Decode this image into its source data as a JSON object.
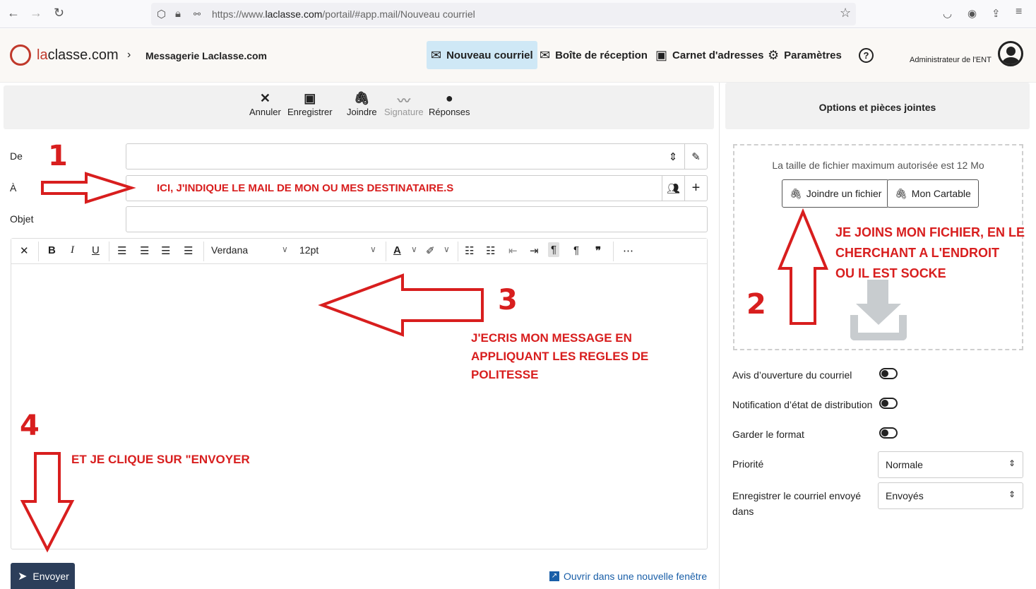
{
  "browser": {
    "url_prefix": "https://www.",
    "url_domain": "laclasse.com",
    "url_path": "/portail/#app.mail/Nouveau courriel"
  },
  "header": {
    "logo_la": "la",
    "logo_rest": "classe.com",
    "crumb": "Messagerie Laclasse.com",
    "nav": {
      "new_mail": "Nouveau courriel",
      "inbox": "Boîte de réception",
      "contacts": "Carnet d'adresses",
      "settings": "Paramètres"
    },
    "user": "Administrateur de l'ENT"
  },
  "toolbar": {
    "cancel": "Annuler",
    "save": "Enregistrer",
    "attach": "Joindre",
    "signature": "Signature",
    "replies": "Réponses"
  },
  "form": {
    "from_label": "De",
    "to_label": "À",
    "subject_label": "Objet"
  },
  "editor": {
    "font": "Verdana",
    "size": "12pt"
  },
  "side": {
    "title": "Options et pièces jointes",
    "max_size": "La taille de fichier maximum autorisée est 12 Mo",
    "attach_file": "Joindre un fichier",
    "cartable": "Mon Cartable",
    "options": {
      "read_receipt": "Avis d’ouverture du courriel",
      "delivery": "Notification d’état de distribution",
      "keep_format": "Garder le format",
      "priority_label": "Priorité",
      "priority_value": "Normale",
      "save_in_label_1": "Enregistrer le courriel envoyé",
      "save_in_label_2": "dans",
      "save_in_value": "Envoyés"
    }
  },
  "footer": {
    "send": "Envoyer",
    "new_window": "Ouvrir dans une nouvelle fenêtre"
  },
  "annotations": {
    "n1": "1",
    "n2": "2",
    "n3": "3",
    "n4": "4",
    "a1": "ICI, J'INDIQUE LE MAIL DE MON OU MES DESTINATAIRE.S",
    "a2_l1": "JE JOINS MON FICHIER, EN LE",
    "a2_l2": "CHERCHANT A L'ENDROIT",
    "a2_l3": "OU IL EST SOCKE",
    "a3_l1": "J'ECRIS MON MESSAGE EN",
    "a3_l2": "APPLIQUANT LES REGLES DE",
    "a3_l3": "POLITESSE",
    "a4": "ET JE CLIQUE SUR \"ENVOYER",
    "color": "#d81e1e"
  }
}
